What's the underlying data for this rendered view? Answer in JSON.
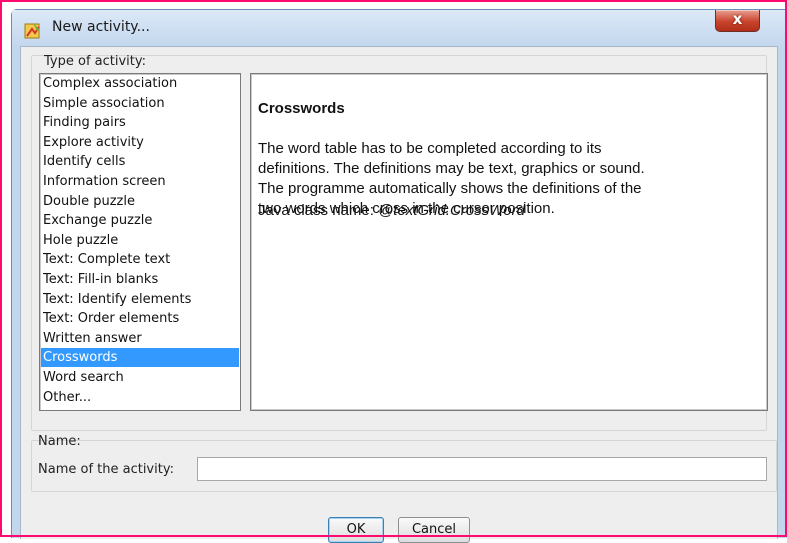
{
  "window": {
    "title": "New activity...",
    "close_label": "x"
  },
  "type_group": {
    "label": "Type of activity:"
  },
  "activity_list": {
    "items": [
      "Complex association",
      "Simple association",
      "Finding pairs",
      "Explore activity",
      "Identify cells",
      "Information screen",
      "Double puzzle",
      "Exchange puzzle",
      "Hole puzzle",
      "Text: Complete text",
      "Text: Fill-in blanks",
      "Text: Identify elements",
      "Text: Order elements",
      "Written answer",
      "Crosswords",
      "Word search",
      "Other..."
    ],
    "selected": "Crosswords"
  },
  "description": {
    "title": "Crosswords",
    "lines": [
      "The word table has to be completed according to its",
      "definitions. The definitions may be text, graphics or sound.",
      "The programme automatically shows the definitions of the",
      "two words which cross in the cursor position."
    ],
    "class_label": "Java class name: ",
    "class_name": "@textGrid.CrossWord"
  },
  "name_group": {
    "label": "Name:",
    "field_label": "Name of the activity:",
    "value": ""
  },
  "buttons": {
    "ok": "OK",
    "cancel": "Cancel"
  },
  "colors": {
    "highlight_frame": "#ff0a6e",
    "selection": "#3399ff",
    "close_button": "#c9432c"
  },
  "icons": {
    "app": "activity-icon",
    "close": "close-icon"
  }
}
